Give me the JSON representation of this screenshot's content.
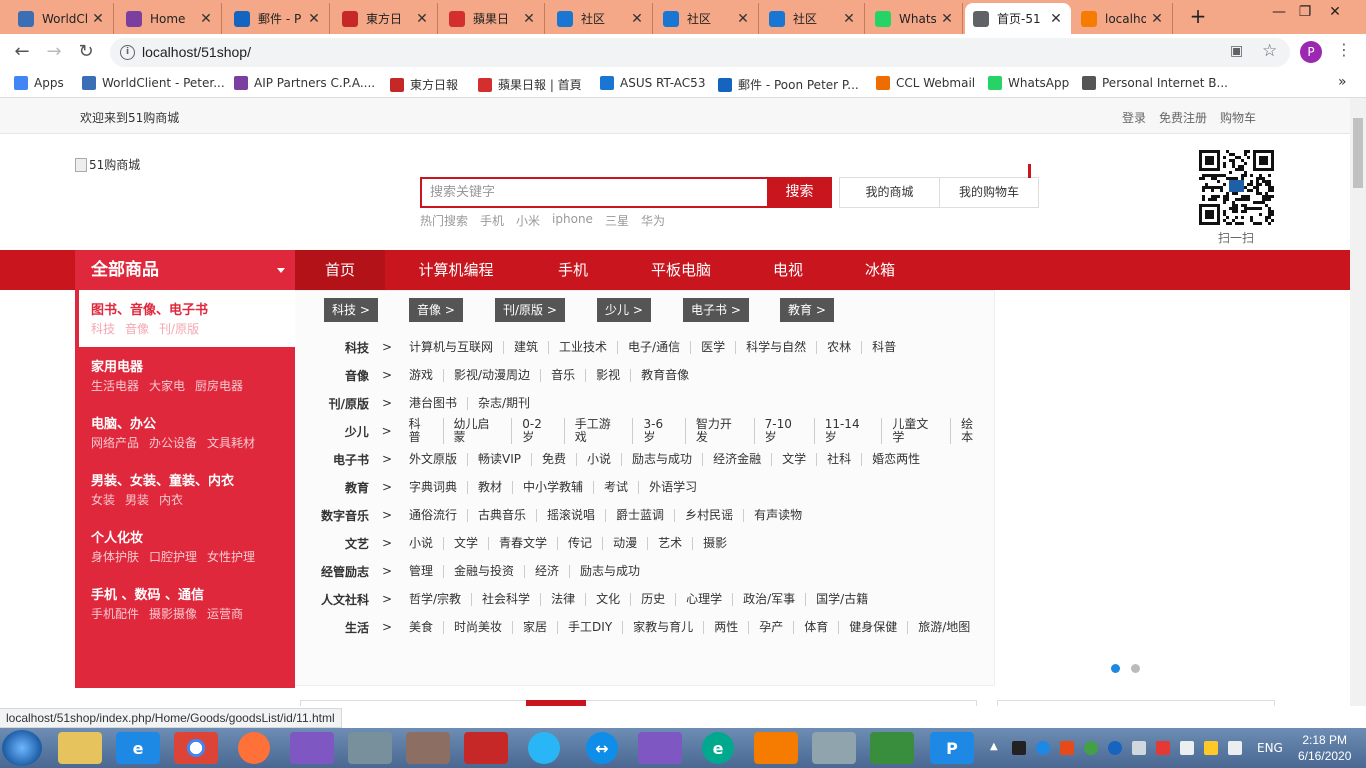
{
  "browser": {
    "tabs": [
      {
        "title": "WorldCl",
        "icon": "worldclient-icon",
        "color": "#3b6fb5"
      },
      {
        "title": "Home",
        "icon": "aip-icon",
        "color": "#7b3fa0"
      },
      {
        "title": "郵件 - P",
        "icon": "outlook-icon",
        "color": "#1565c0"
      },
      {
        "title": "東方日",
        "icon": "oriental-daily-icon",
        "color": "#c62828"
      },
      {
        "title": "蘋果日",
        "icon": "apple-daily-icon",
        "color": "#d32f2f"
      },
      {
        "title": "社区",
        "icon": "community-icon",
        "color": "#1976d2"
      },
      {
        "title": "社区",
        "icon": "community-icon",
        "color": "#1976d2"
      },
      {
        "title": "社区",
        "icon": "community-icon",
        "color": "#1976d2"
      },
      {
        "title": "WhatsA",
        "icon": "whatsapp-icon",
        "color": "#25d366"
      },
      {
        "title": "首页-51",
        "icon": "globe-icon",
        "color": "#5f6368"
      },
      {
        "title": "localho",
        "icon": "pma-icon",
        "color": "#f57c00"
      }
    ],
    "url": "localhost/51shop/",
    "profile_initial": "P",
    "bookmarks": [
      {
        "label": "Apps",
        "color": "#4285f4"
      },
      {
        "label": "WorldClient - Peter...",
        "color": "#3b6fb5"
      },
      {
        "label": "AIP Partners C.P.A....",
        "color": "#7b3fa0"
      },
      {
        "label": "東方日報",
        "color": "#c62828"
      },
      {
        "label": "蘋果日報 | 首頁",
        "color": "#d32f2f"
      },
      {
        "label": "ASUS RT-AC53",
        "color": "#1976d2"
      },
      {
        "label": "郵件 - Poon Peter P...",
        "color": "#1565c0"
      },
      {
        "label": "CCL Webmail",
        "color": "#ef6c00"
      },
      {
        "label": "WhatsApp",
        "color": "#25d366"
      },
      {
        "label": "Personal Internet B...",
        "color": "#555555"
      }
    ],
    "bookmarks_more": "»",
    "status_url": "localhost/51shop/index.php/Home/Goods/goodsList/id/11.html"
  },
  "site": {
    "welcome": "欢迎来到51购商城",
    "top_links": [
      "登录",
      "免费注册",
      "购物车"
    ],
    "logo_alt": "51购商城",
    "search": {
      "placeholder": "搜索关键字",
      "button": "搜索"
    },
    "hot_label": "热门搜索",
    "hot_words": [
      "手机",
      "小米",
      "iphone",
      "三星",
      "华为"
    ],
    "my_mall": "我的商城",
    "my_cart": "我的购物车",
    "scan": "扫一扫",
    "all_goods": "全部商品",
    "nav": [
      "首页",
      "计算机编程",
      "手机",
      "平板电脑",
      "电视",
      "冰箱"
    ],
    "side_categories": [
      {
        "title": "图书、音像、电子书",
        "subs": [
          "科技",
          "音像",
          "刊/原版"
        ]
      },
      {
        "title": "家用电器",
        "subs": [
          "生活电器",
          "大家电",
          "厨房电器"
        ]
      },
      {
        "title": "电脑、办公",
        "subs": [
          "网络产品",
          "办公设备",
          "文具耗材"
        ]
      },
      {
        "title": "男装、女装、童装、内衣",
        "subs": [
          "女装",
          "男装",
          "内衣"
        ]
      },
      {
        "title": "个人化妆",
        "subs": [
          "身体护肤",
          "口腔护理",
          "女性护理"
        ]
      },
      {
        "title": "手机 、数码 、通信",
        "subs": [
          "手机配件",
          "摄影摄像",
          "运营商"
        ]
      }
    ],
    "flyout_tags": [
      "科技 >",
      "音像 >",
      "刊/原版 >",
      "少儿 >",
      "电子书 >",
      "教育 >"
    ],
    "flyout_rows": [
      {
        "label": "科技",
        "links": [
          "计算机与互联网",
          "建筑",
          "工业技术",
          "电子/通信",
          "医学",
          "科学与自然",
          "农林",
          "科普"
        ]
      },
      {
        "label": "音像",
        "links": [
          "游戏",
          "影视/动漫周边",
          "音乐",
          "影视",
          "教育音像"
        ]
      },
      {
        "label": "刊/原版",
        "links": [
          "港台图书",
          "杂志/期刊"
        ]
      },
      {
        "label": "少儿",
        "links": [
          "科普",
          "幼儿启蒙",
          "0-2岁",
          "手工游戏",
          "3-6岁",
          "智力开发",
          "7-10岁",
          "11-14岁",
          "儿童文学",
          "绘本"
        ]
      },
      {
        "label": "电子书",
        "links": [
          "外文原版",
          "畅读VIP",
          "免费",
          "小说",
          "励志与成功",
          "经济金融",
          "文学",
          "社科",
          "婚恋两性"
        ]
      },
      {
        "label": "教育",
        "links": [
          "字典词典",
          "教材",
          "中小学教辅",
          "考试",
          "外语学习"
        ]
      },
      {
        "label": "数字音乐",
        "links": [
          "通俗流行",
          "古典音乐",
          "摇滚说唱",
          "爵士蓝调",
          "乡村民谣",
          "有声读物"
        ]
      },
      {
        "label": "文艺",
        "links": [
          "小说",
          "文学",
          "青春文学",
          "传记",
          "动漫",
          "艺术",
          "摄影"
        ]
      },
      {
        "label": "经管励志",
        "links": [
          "管理",
          "金融与投资",
          "经济",
          "励志与成功"
        ]
      },
      {
        "label": "人文社科",
        "links": [
          "哲学/宗教",
          "社会科学",
          "法律",
          "文化",
          "历史",
          "心理学",
          "政治/军事",
          "国学/古籍"
        ]
      },
      {
        "label": "生活",
        "links": [
          "美食",
          "时尚美妆",
          "家居",
          "手工DIY",
          "家教与育儿",
          "两性",
          "孕产",
          "体育",
          "健身保健",
          "旅游/地图"
        ]
      }
    ],
    "gt": ">"
  },
  "taskbar": {
    "lang": "ENG",
    "time": "2:18 PM",
    "date": "6/16/2020"
  },
  "colors": {
    "brand_red": "#c9151e",
    "side_red": "#e0283d",
    "tab_bar": "#f5a887"
  }
}
